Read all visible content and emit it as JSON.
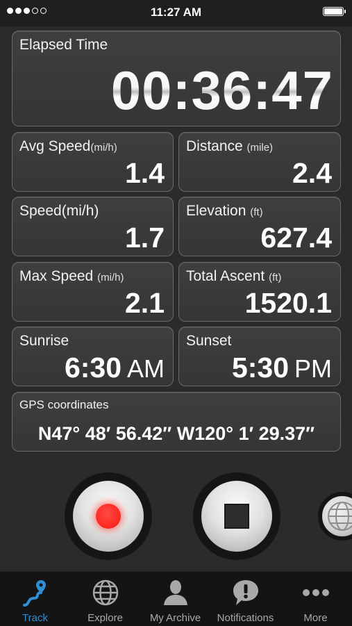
{
  "status_bar": {
    "time": "11:27 AM"
  },
  "elapsed": {
    "label": "Elapsed Time",
    "value": "00:36:47"
  },
  "stats": {
    "avg_speed": {
      "label": "Avg Speed",
      "unit": "(mi/h)",
      "value": "1.4"
    },
    "distance": {
      "label": "Distance",
      "unit": "(mile)",
      "value": "2.4"
    },
    "speed": {
      "label": "Speed",
      "unit": "(mi/h)",
      "value": "1.7"
    },
    "elevation": {
      "label": "Elevation",
      "unit": "(ft)",
      "value": "627.4"
    },
    "max_speed": {
      "label": "Max Speed",
      "unit": "(mi/h)",
      "value": "2.1"
    },
    "total_ascent": {
      "label": "Total Ascent",
      "unit": "(ft)",
      "value": "1520.1"
    },
    "sunrise": {
      "label": "Sunrise",
      "value": "6:30",
      "ampm": "AM"
    },
    "sunset": {
      "label": "Sunset",
      "value": "5:30",
      "ampm": "PM"
    }
  },
  "gps": {
    "label": "GPS coordinates",
    "value": "N47° 48′ 56.42″  W120° 1′ 29.37″"
  },
  "controls": {
    "record_icon": "record-icon",
    "stop_icon": "stop-icon",
    "map_icon": "globe-icon"
  },
  "tabs": [
    {
      "label": "Track",
      "icon": "track-icon",
      "active": true
    },
    {
      "label": "Explore",
      "icon": "globe-icon",
      "active": false
    },
    {
      "label": "My Archive",
      "icon": "person-icon",
      "active": false
    },
    {
      "label": "Notifications",
      "icon": "speech-bubble-icon",
      "active": false
    },
    {
      "label": "More",
      "icon": "more-icon",
      "active": false
    }
  ],
  "colors": {
    "accent": "#2e8fd6",
    "record_red": "#ff2b24",
    "background": "#2b2b2b"
  }
}
